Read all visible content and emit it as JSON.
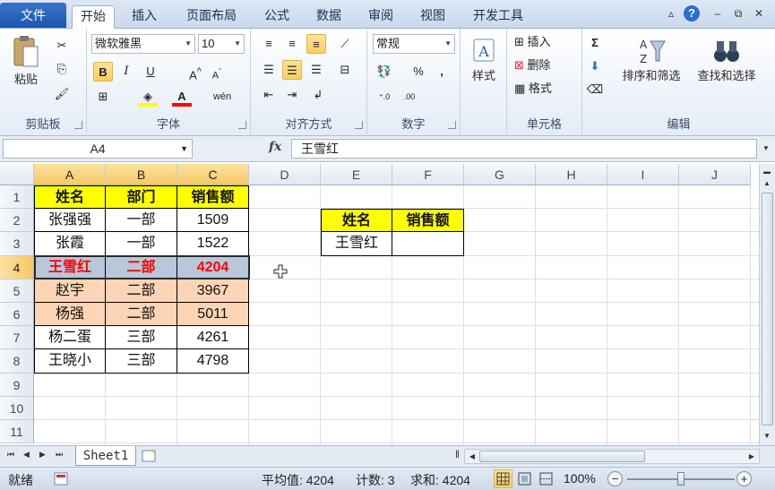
{
  "ribbon_tabs": [
    "文件",
    "开始",
    "插入",
    "页面布局",
    "公式",
    "数据",
    "审阅",
    "视图",
    "开发工具"
  ],
  "active_tab": "开始",
  "clipboard": {
    "paste": "粘贴",
    "group": "剪贴板"
  },
  "font": {
    "name": "微软雅黑",
    "size": "10",
    "group": "字体",
    "bold": "B",
    "italic": "I",
    "underline": "U"
  },
  "alignment": {
    "group": "对齐方式"
  },
  "number": {
    "format": "常规",
    "group": "数字",
    "percent": "%",
    "comma": ","
  },
  "styles": {
    "label": "样式"
  },
  "cells": {
    "insert": "插入",
    "delete": "删除",
    "format": "格式",
    "group": "单元格"
  },
  "editing": {
    "sort": "排序和筛选",
    "find": "查找和选择",
    "group": "编辑",
    "sigma": "Σ"
  },
  "formula_bar": {
    "name_box": "A4",
    "fx": "fx",
    "value": "王雪红"
  },
  "columns": [
    "A",
    "B",
    "C",
    "D",
    "E",
    "F",
    "G",
    "H",
    "I",
    "J"
  ],
  "rows": [
    "1",
    "2",
    "3",
    "4",
    "5",
    "6",
    "7",
    "8",
    "9",
    "10",
    "11"
  ],
  "table": {
    "headers": [
      "姓名",
      "部门",
      "销售额"
    ],
    "rows": [
      [
        "张强强",
        "一部",
        "1509"
      ],
      [
        "张霞",
        "一部",
        "1522"
      ],
      [
        "王雪红",
        "二部",
        "4204"
      ],
      [
        "赵宇",
        "二部",
        "3967"
      ],
      [
        "杨强",
        "二部",
        "5011"
      ],
      [
        "杨二蛋",
        "三部",
        "4261"
      ],
      [
        "王晓小",
        "三部",
        "4798"
      ]
    ]
  },
  "lookup": {
    "headers": [
      "姓名",
      "销售额"
    ],
    "name": "王雪红",
    "value": ""
  },
  "sheet_tab": "Sheet1",
  "status": {
    "ready": "就绪",
    "average": "平均值: 4204",
    "count": "计数: 3",
    "sum": "求和: 4204",
    "zoom": "100%"
  },
  "colors": {
    "header_fill": "#ffff00",
    "highlight_fill": "#fbd5b5",
    "red_text": "#ff0000",
    "selected_row": "#b8c7d9"
  }
}
